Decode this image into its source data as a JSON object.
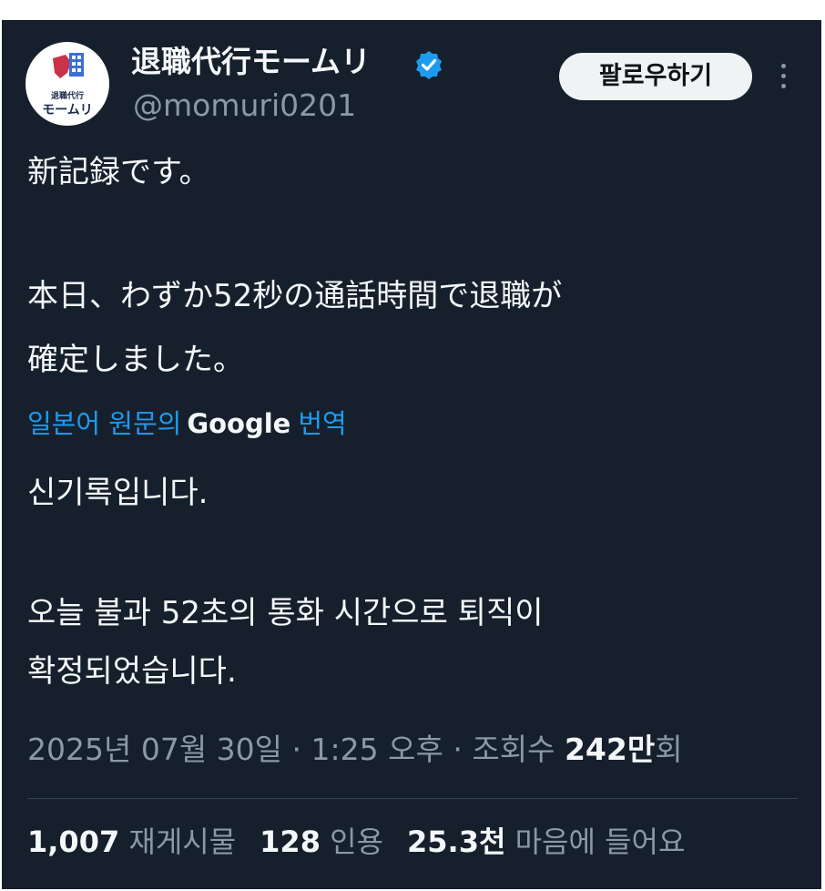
{
  "author": {
    "name": "退職代行モームリ",
    "handle": "@momuri0201",
    "avatar_small_text": "退職代行",
    "avatar_big_text": "モームリ"
  },
  "follow_label": "팔로우하기",
  "tweet": {
    "line1": "新記録です。",
    "line2": "本日、わずか52秒の通話時間で退職が",
    "line3": "確定しました。"
  },
  "translation_bar": {
    "prefix": "일본어 원문의",
    "brand": "Google",
    "suffix": "번역"
  },
  "translated": {
    "line1": "신기록입니다.",
    "line2": "오늘 불과 52초의 통화 시간으로 퇴직이",
    "line3": "확정되었습니다."
  },
  "meta": {
    "date": "2025년 07월 30일",
    "sep1": "·",
    "time": "1:25 오후",
    "sep2": "·",
    "views_label": "조회수",
    "views_value": "242만",
    "views_suffix": "회"
  },
  "stats": {
    "retweets_value": "1,007",
    "retweets_label": "재게시물",
    "quotes_value": "128",
    "quotes_label": "인용",
    "likes_value": "25.3천",
    "likes_label": "마음에 들어요"
  },
  "colors": {
    "background": "#16202c",
    "link": "#1d9bf0",
    "verified": "#1d9bf0",
    "muted": "#8b98a5"
  },
  "icons": {
    "verified": "verified-badge-icon",
    "more": "more-options-icon"
  }
}
